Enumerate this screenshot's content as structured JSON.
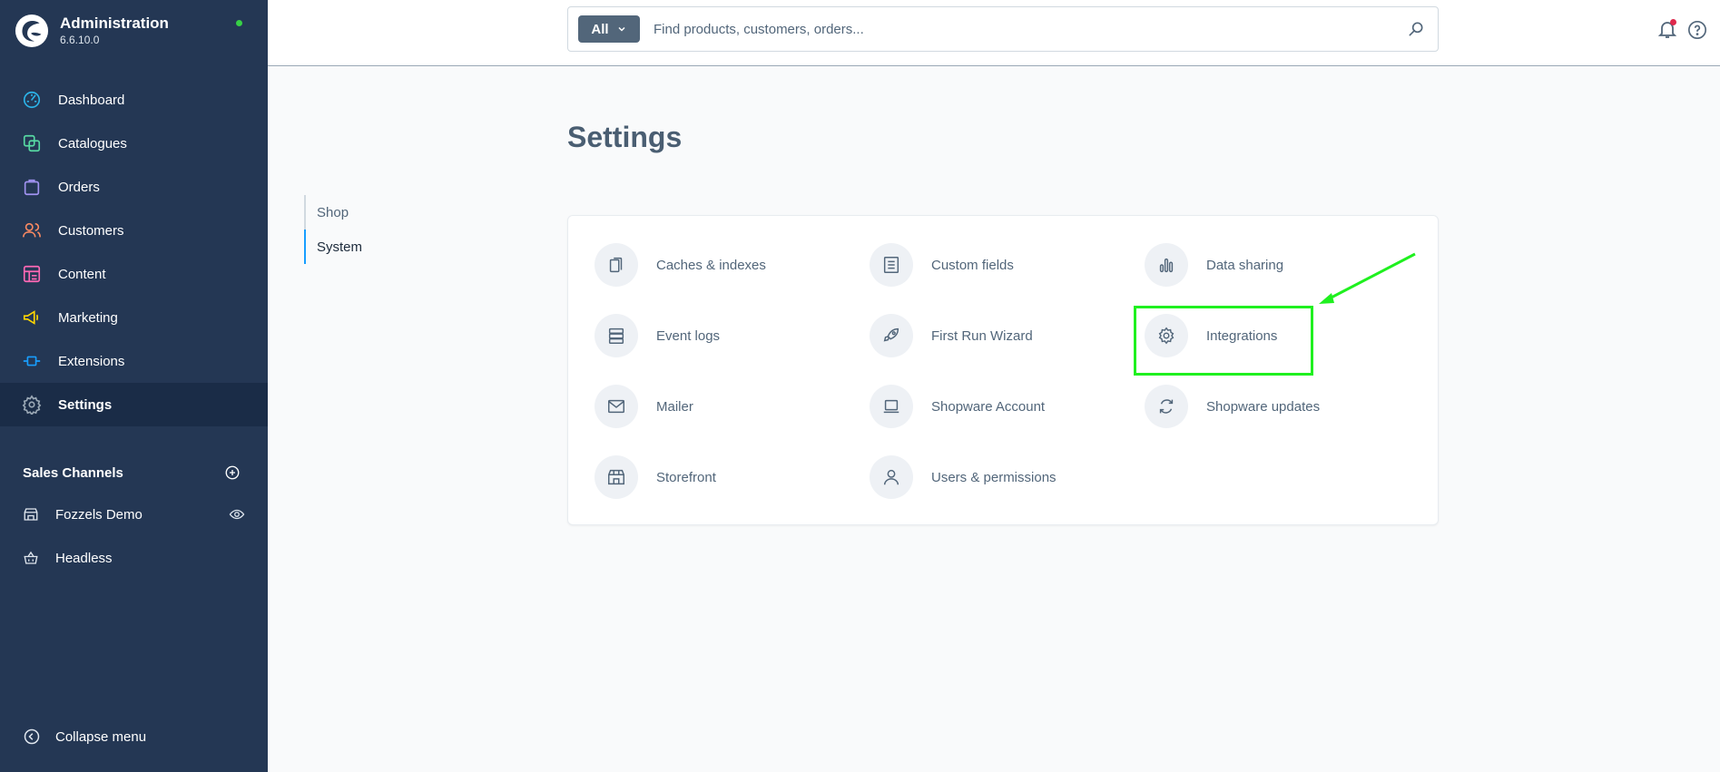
{
  "app": {
    "title": "Administration",
    "version": "6.6.10.0"
  },
  "sidebar": {
    "items": [
      {
        "label": "Dashboard",
        "icon": "dashboard-icon"
      },
      {
        "label": "Catalogues",
        "icon": "catalogue-icon"
      },
      {
        "label": "Orders",
        "icon": "orders-icon"
      },
      {
        "label": "Customers",
        "icon": "customers-icon"
      },
      {
        "label": "Content",
        "icon": "content-icon"
      },
      {
        "label": "Marketing",
        "icon": "marketing-icon"
      },
      {
        "label": "Extensions",
        "icon": "extensions-icon"
      },
      {
        "label": "Settings",
        "icon": "gear-icon",
        "active": true
      }
    ],
    "sales_channels_title": "Sales Channels",
    "channels": [
      {
        "label": "Fozzels Demo",
        "icon": "storefront-icon"
      },
      {
        "label": "Headless",
        "icon": "basket-icon"
      }
    ],
    "collapse_label": "Collapse menu",
    "colors": {
      "background": "#243754",
      "active": "#1a2c47"
    }
  },
  "search": {
    "type_label": "All",
    "placeholder": "Find products, customers, orders..."
  },
  "page": {
    "title": "Settings",
    "tabs": [
      {
        "label": "Shop",
        "active": false
      },
      {
        "label": "System",
        "active": true
      }
    ],
    "tiles": [
      {
        "label": "Caches & indexes",
        "icon": "caches-icon"
      },
      {
        "label": "Custom fields",
        "icon": "custom-fields-icon"
      },
      {
        "label": "Data sharing",
        "icon": "bar-chart-icon"
      },
      {
        "label": "Event logs",
        "icon": "event-logs-icon"
      },
      {
        "label": "First Run Wizard",
        "icon": "rocket-icon"
      },
      {
        "label": "Integrations",
        "icon": "gear-icon"
      },
      {
        "label": "Mailer",
        "icon": "envelope-icon"
      },
      {
        "label": "Shopware Account",
        "icon": "laptop-icon"
      },
      {
        "label": "Shopware updates",
        "icon": "refresh-icon"
      },
      {
        "label": "Storefront",
        "icon": "storefront-icon"
      },
      {
        "label": "Users & permissions",
        "icon": "user-icon"
      }
    ]
  },
  "annotation": {
    "color": "#1ff01f",
    "target": "Integrations"
  }
}
